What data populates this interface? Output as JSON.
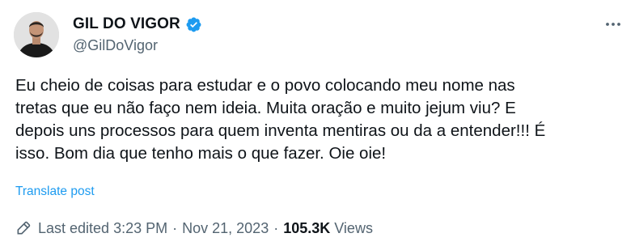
{
  "author": {
    "name": "GIL DO VIGOR",
    "handle": "@GilDoVigor",
    "verified_color": "#1d9bf0"
  },
  "tweet": {
    "text": "Eu cheio de coisas para estudar e o povo colocando meu nome nas\ntretas que eu não faço nem ideia. Muita oração e muito jejum viu? E\ndepois uns processos para quem inventa mentiras ou da a entender!!! É\nisso. Bom dia que tenho mais o que fazer. Oie oie!",
    "translate_label": "Translate post"
  },
  "meta": {
    "edited_label": "Last edited",
    "time": "3:23 PM",
    "separator": "·",
    "date": "Nov 21, 2023",
    "views_count": "105.3K",
    "views_label": "Views"
  },
  "icons": {
    "more": "more-options-icon",
    "verified": "verified-badge-icon",
    "edit": "pencil-icon"
  },
  "colors": {
    "accent": "#1d9bf0",
    "text": "#0f1419",
    "secondary": "#536471"
  }
}
